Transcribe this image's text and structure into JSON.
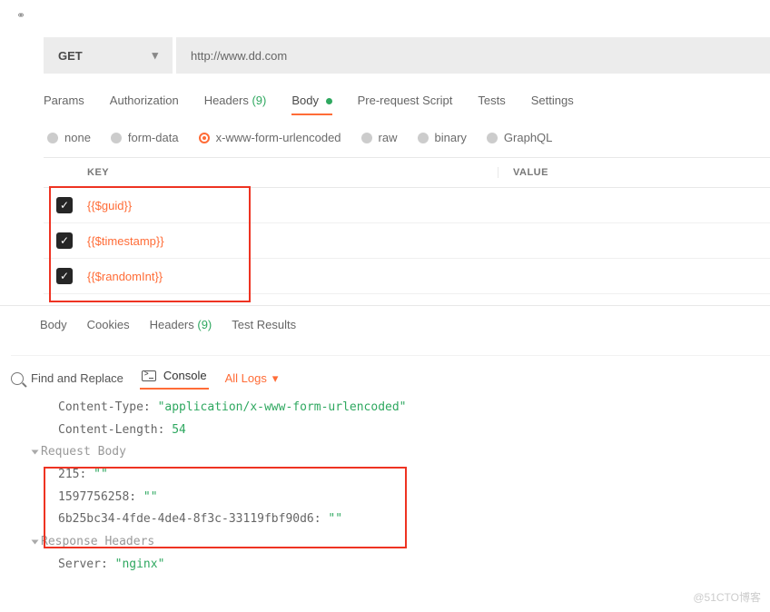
{
  "topbar": {
    "icon_glyph": "⚭"
  },
  "request": {
    "method": "GET",
    "url": "http://www.dd.com"
  },
  "tabs": {
    "params": "Params",
    "authorization": "Authorization",
    "headers": "Headers",
    "headers_count": "(9)",
    "body": "Body",
    "prerequest": "Pre-request Script",
    "tests": "Tests",
    "settings": "Settings"
  },
  "body_types": {
    "none": "none",
    "form_data": "form-data",
    "urlencoded": "x-www-form-urlencoded",
    "raw": "raw",
    "binary": "binary",
    "graphql": "GraphQL"
  },
  "table": {
    "key_header": "KEY",
    "value_header": "VALUE",
    "rows": [
      {
        "key": "{{$guid}}"
      },
      {
        "key": "{{$timestamp}}"
      },
      {
        "key": "{{$randomInt}}"
      }
    ]
  },
  "response_tabs": {
    "body": "Body",
    "cookies": "Cookies",
    "headers": "Headers",
    "headers_count": "(9)",
    "test_results": "Test Results"
  },
  "bottom": {
    "find_replace": "Find and Replace",
    "console": "Console",
    "all_logs": "All Logs"
  },
  "console_output": {
    "content_type_label": "Content-Type:",
    "content_type_value": "\"application/x-www-form-urlencoded\"",
    "content_length_label": "Content-Length:",
    "content_length_value": "54",
    "request_body_label": "Request Body",
    "body_lines": [
      {
        "k": "215:",
        "v": "\"\""
      },
      {
        "k": "1597756258:",
        "v": "\"\""
      },
      {
        "k": "6b25bc34-4fde-4de4-8f3c-33119fbf90d6:",
        "v": "\"\""
      }
    ],
    "response_headers_label": "Response Headers",
    "server_label": "Server:",
    "server_value": "\"nginx\""
  },
  "watermark": "@51CTO博客"
}
